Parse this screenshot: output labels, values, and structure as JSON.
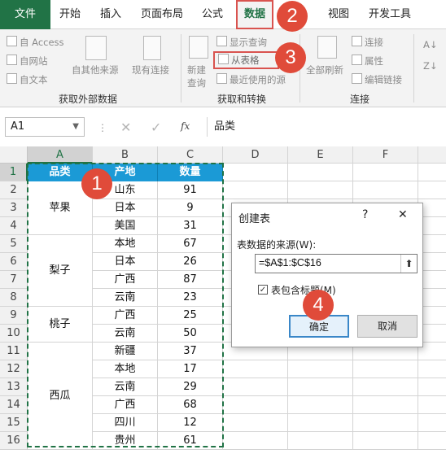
{
  "ribbon_tabs": [
    "文件",
    "开始",
    "插入",
    "页面布局",
    "公式",
    "数据",
    "视图",
    "开发工具"
  ],
  "ribbon": {
    "ext_group": {
      "access": "自 Access",
      "web": "自网站",
      "text": "自文本",
      "other": "自其他来源",
      "existing": "现有连接",
      "label": "获取外部数据"
    },
    "transform_group": {
      "new_query": "新建",
      "new_query2": "查询",
      "show_query": "显示查询",
      "from_table": "从表格",
      "recent": "最近使用的源",
      "label": "获取和转换"
    },
    "conn_group": {
      "refresh_all": "全部刷新",
      "connections": "连接",
      "properties": "属性",
      "edit_links": "编辑链接",
      "label": "连接"
    },
    "sort_glyphs": [
      "A↓",
      "Z↓"
    ]
  },
  "formula_bar": {
    "name_box": "A1",
    "fx": "fx",
    "content": "品类"
  },
  "columns": [
    "A",
    "B",
    "C",
    "D",
    "E",
    "F"
  ],
  "rows": [
    "1",
    "2",
    "3",
    "4",
    "5",
    "6",
    "7",
    "8",
    "9",
    "10",
    "11",
    "12",
    "13",
    "14",
    "15",
    "16"
  ],
  "table": {
    "headers": [
      "品类",
      "产地",
      "数量"
    ],
    "groups": [
      {
        "category": "苹果",
        "rows": [
          [
            "山东",
            "91"
          ],
          [
            "日本",
            "9"
          ],
          [
            "美国",
            "31"
          ]
        ]
      },
      {
        "category": "梨子",
        "rows": [
          [
            "本地",
            "67"
          ],
          [
            "日本",
            "26"
          ],
          [
            "广西",
            "87"
          ],
          [
            "云南",
            "23"
          ]
        ]
      },
      {
        "category": "桃子",
        "rows": [
          [
            "广西",
            "25"
          ],
          [
            "云南",
            "50"
          ]
        ]
      },
      {
        "category": "西瓜",
        "rows": [
          [
            "新疆",
            "37"
          ],
          [
            "本地",
            "17"
          ],
          [
            "云南",
            "29"
          ],
          [
            "广西",
            "68"
          ],
          [
            "四川",
            "12"
          ],
          [
            "贵州",
            "61"
          ]
        ]
      }
    ]
  },
  "dialog": {
    "title": "创建表",
    "help": "?",
    "close": "✕",
    "source_label": "表数据的来源(W):",
    "range_value": "=$A$1:$C$16",
    "header_checkbox_label": "表包含标题(M)",
    "ok": "确定",
    "cancel": "取消"
  },
  "callouts": [
    "1",
    "2",
    "3",
    "4"
  ],
  "colors": {
    "accent": "#217346",
    "header_fill": "#1b9ad6",
    "callout": "#e04b3a",
    "selection": "#217346"
  }
}
